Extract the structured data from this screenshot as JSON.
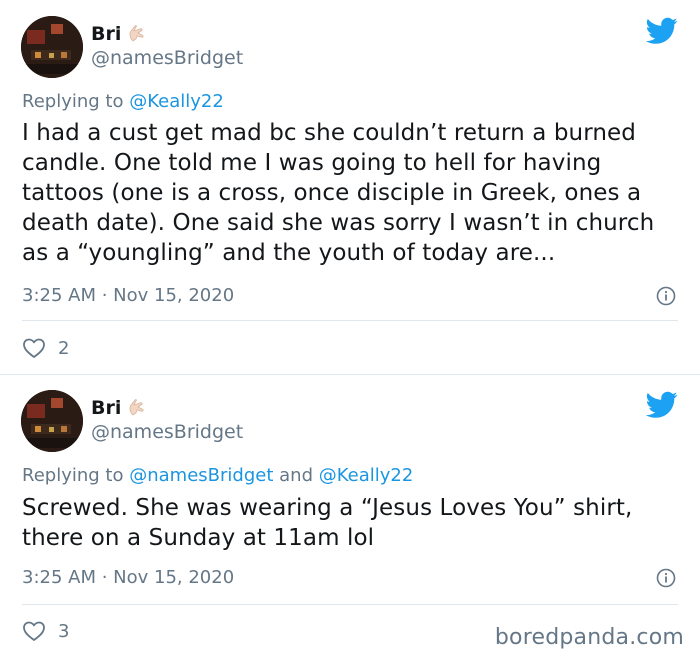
{
  "tweets": [
    {
      "author_name": "Bri",
      "author_emoji": "🤙",
      "handle": "@namesBridget",
      "replying_prefix": "Replying to",
      "replying_to": "@Keally22",
      "text": "I had a cust get mad bc she couldn’t return a burned candle. One told me I was going to hell for having tattoos (one is a cross, once disciple in Greek, ones a death date). One said she was sorry I wasn’t in church as a “youngling” and the youth of today are...",
      "timestamp": "3:25 AM · Nov 15, 2020",
      "like_count": "2"
    },
    {
      "author_name": "Bri",
      "author_emoji": "🤙",
      "handle": "@namesBridget",
      "replying_prefix": "Replying to",
      "replying_to_1": "@namesBridget",
      "replying_and": "and",
      "replying_to_2": "@Keally22",
      "text": "Screwed. She was wearing a “Jesus Loves You” shirt, there on a Sunday at 11am lol",
      "timestamp": "3:25 AM · Nov 15, 2020",
      "like_count": "3"
    }
  ],
  "watermark": "boredpanda.com",
  "colors": {
    "twitter_blue": "#1da1f2",
    "link_blue": "#1b95e0",
    "secondary_text": "#657786",
    "primary_text": "#14171a",
    "divider": "#e1e8ed"
  },
  "icons": {
    "logo": "twitter-bird-icon",
    "info": "info-icon",
    "like": "heart-icon"
  }
}
